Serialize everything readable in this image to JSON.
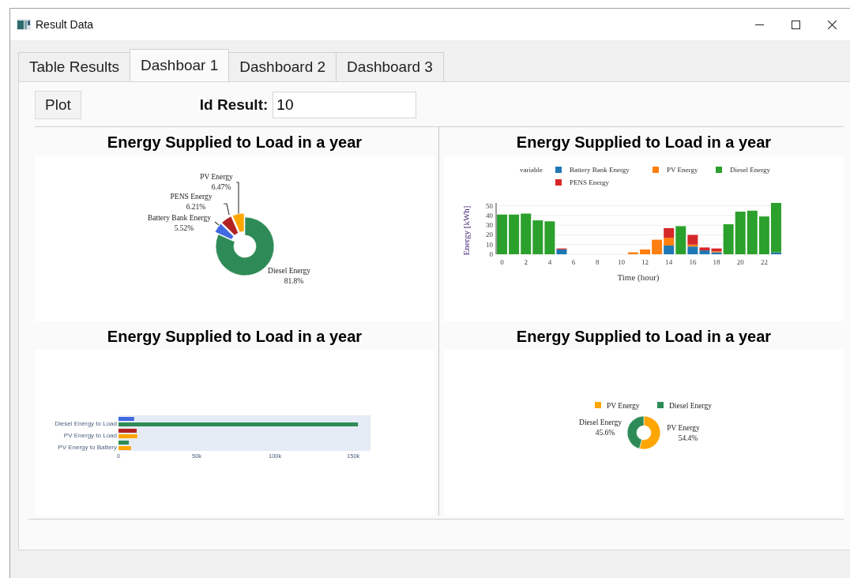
{
  "window": {
    "title": "Result Data"
  },
  "tabs": [
    {
      "label": "Table Results",
      "selected": false
    },
    {
      "label": "Dashboar 1",
      "selected": true
    },
    {
      "label": "Dashboard 2",
      "selected": false
    },
    {
      "label": "Dashboard 3",
      "selected": false
    }
  ],
  "toolbar": {
    "plot_button": "Plot",
    "id_label": "Id Result:",
    "id_value": "10"
  },
  "panels": [
    {
      "title": "Energy Supplied to Load in a year",
      "chart_data": {
        "type": "donut",
        "legend": false,
        "categories": [
          "Diesel Energy",
          "Battery Bank Energy",
          "PENS Energy",
          "PV Energy"
        ],
        "values": [
          81.8,
          5.52,
          6.21,
          6.47
        ],
        "value_labels": [
          "81.8%",
          "5.52%",
          "6.21%",
          "6.47%"
        ],
        "colors": [
          "#2e8b57",
          "#4169e1",
          "#b22222",
          "#ffa500"
        ]
      }
    },
    {
      "title": "Energy Supplied to Load in a year",
      "chart_data": {
        "type": "bar",
        "stacked": true,
        "grid": true,
        "legend": true,
        "xlim": [
          -0.5,
          23.5
        ],
        "ylim": [
          0,
          53
        ],
        "legend_title": "variable",
        "xlabel": "Time (hour)",
        "ylabel": "Energy [kWh]",
        "x": [
          0,
          1,
          2,
          3,
          4,
          5,
          11,
          12,
          13,
          14,
          15,
          16,
          17,
          18,
          19,
          20,
          21,
          22,
          23
        ],
        "xticks": [
          0,
          2,
          4,
          6,
          8,
          10,
          12,
          14,
          16,
          18,
          20,
          22
        ],
        "yticks": [
          0,
          10,
          20,
          30,
          40,
          50
        ],
        "series": [
          {
            "name": "Battery Bank Energy",
            "color": "#1f77b4",
            "values": [
              0,
              0,
              0,
              0,
              0,
              5,
              0,
              0,
              0,
              9,
              0,
              8,
              4,
              2,
              0,
              0,
              0,
              0,
              2
            ]
          },
          {
            "name": "PV Energy",
            "color": "#ff7f0e",
            "values": [
              0,
              0,
              0,
              0,
              0,
              0,
              2,
              5,
              15,
              8,
              0,
              2,
              0,
              1,
              0,
              0,
              0,
              0,
              0
            ]
          },
          {
            "name": "Diesel Energy",
            "color": "#2ca02c",
            "values": [
              41,
              41,
              42,
              35,
              34,
              0,
              0,
              0,
              0,
              0,
              29,
              0,
              0,
              0,
              31,
              44,
              45,
              39,
              51
            ]
          },
          {
            "name": "PENS Energy",
            "color": "#d62728",
            "values": [
              0,
              0,
              0,
              0,
              0,
              1,
              0,
              0,
              0,
              10,
              0,
              10,
              3,
              3,
              0,
              0,
              0,
              0,
              0
            ]
          }
        ]
      }
    },
    {
      "title": "Energy Supplied to Load in a year",
      "chart_data": {
        "type": "bar",
        "orientation": "h",
        "categories": [
          "Diesel Energy to Load",
          "PV Energy to Load",
          "PV Energy to Battery"
        ],
        "xlim": [
          0,
          161000
        ],
        "xticks": [
          {
            "value": 0,
            "label": "0"
          },
          {
            "value": 50000,
            "label": "50k"
          },
          {
            "value": 100000,
            "label": "100k"
          },
          {
            "value": 150000,
            "label": "150k"
          }
        ],
        "series": [
          {
            "color": "#4169e1",
            "values": [
              10000,
              null,
              null
            ]
          },
          {
            "color": "#b22222",
            "values": [
              null,
              11600,
              null
            ]
          },
          {
            "color": "#2e8b57",
            "values": [
              153000,
              null,
              6600
            ]
          },
          {
            "color": "#ffa500",
            "values": [
              null,
              12000,
              8000
            ]
          }
        ]
      }
    },
    {
      "title": "Energy Supplied to Load in a year",
      "chart_data": {
        "type": "donut",
        "legend": true,
        "categories": [
          "PV Energy",
          "Diesel Energy"
        ],
        "values": [
          54.4,
          45.6
        ],
        "value_labels": [
          "54.4%",
          "45.6%"
        ],
        "colors": [
          "#ffa500",
          "#2e8b57"
        ]
      }
    }
  ]
}
